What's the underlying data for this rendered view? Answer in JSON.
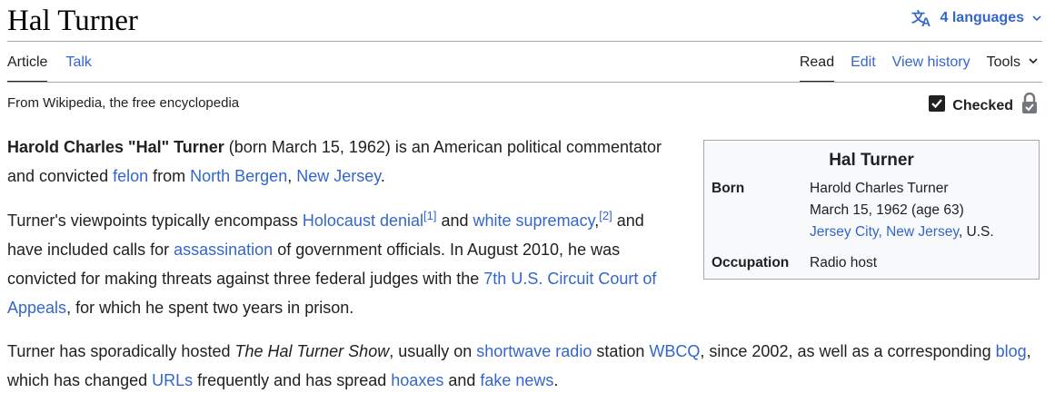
{
  "header": {
    "title": "Hal Turner",
    "languages_label": "4 languages"
  },
  "tabs": {
    "article": "Article",
    "talk": "Talk",
    "read": "Read",
    "edit": "Edit",
    "view_history": "View history",
    "tools": "Tools"
  },
  "tagline": "From Wikipedia, the free encyclopedia",
  "checked_label": "Checked",
  "para1": {
    "bold_name": "Harold Charles \"Hal\" Turner",
    "t1": " (born March 15, 1962) is an American political commentator and convicted ",
    "link_felon": "felon",
    "t2": " from ",
    "link_north_bergen": "North Bergen",
    "t3": ", ",
    "link_new_jersey": "New Jersey",
    "t4": "."
  },
  "para2": {
    "t1": "Turner's viewpoints typically encompass ",
    "link_holocaust_denial": "Holocaust denial",
    "ref1": "[1]",
    "t2": " and ",
    "link_white_supremacy": "white supremacy",
    "t3": ",",
    "ref2": "[2]",
    "t4": " and have included calls for ",
    "link_assassination": "assassination",
    "t5": " of government officials. In August 2010, he was convicted for making threats against three federal judges with the ",
    "link_7th_circuit": "7th U.S. Circuit Court of Appeals",
    "t6": ", for which he spent two years in prison."
  },
  "para3": {
    "t1": "Turner has sporadically hosted ",
    "show_title": "The Hal Turner Show",
    "t2": ", usually on ",
    "link_shortwave": "shortwave radio",
    "t3": " station ",
    "link_wbcq": "WBCQ",
    "t4": ", since 2002, as well as a corresponding ",
    "link_blog": "blog",
    "t5": ", which has changed ",
    "link_urls": "URLs",
    "t6": " frequently and has spread ",
    "link_hoaxes": "hoaxes",
    "t7": " and ",
    "link_fake_news": "fake news",
    "t8": "."
  },
  "infobox": {
    "title": "Hal Turner",
    "born_label": "Born",
    "born_name": "Harold Charles Turner",
    "born_date": "March 15, 1962 (age 63)",
    "born_place_link": "Jersey City, New Jersey",
    "born_place_suffix": ", U.S.",
    "occupation_label": "Occupation",
    "occupation_value": "Radio host"
  },
  "colors": {
    "link": "#3366cc",
    "text": "#202122",
    "rule": "#a2a9b1",
    "infobox_bg": "#f8f9fa"
  },
  "icons": {
    "languages": "translate-icon",
    "dropdown": "chevron-down-icon",
    "checked": "checkbox-checked-icon",
    "lock": "lock-icon"
  }
}
